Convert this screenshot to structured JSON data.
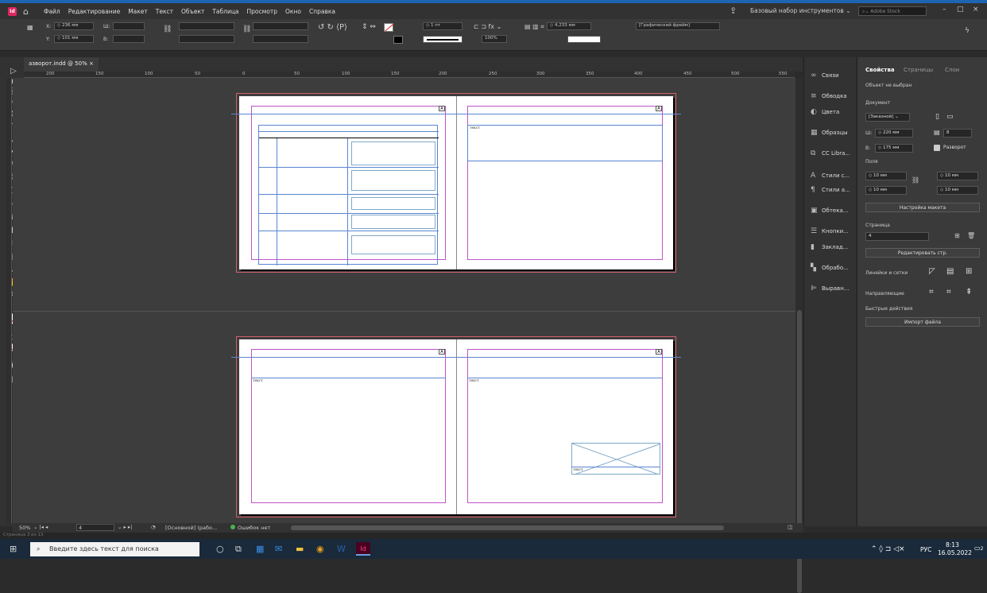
{
  "app": {
    "logo": "Id"
  },
  "menu": [
    "Файл",
    "Редактирование",
    "Макет",
    "Текст",
    "Объект",
    "Таблица",
    "Просмотр",
    "Окно",
    "Справка"
  ],
  "workspace": "Базовый набор инструментов",
  "search_stock": {
    "placeholder": "Adobe Stock"
  },
  "control": {
    "x": "236 мм",
    "y": "101 мм",
    "w_label": "Ш:",
    "h_label": "В:",
    "x_label": "X:",
    "y_label": "Y:",
    "stroke": "1 пт",
    "zoom_pct": "100%",
    "dim": "4,233 мм",
    "frame_type": "[Графический фрейм]"
  },
  "doc_tab": {
    "label": "азворот.indd @ 50%",
    "close": "×"
  },
  "ruler_ticks": [
    "200",
    "150",
    "100",
    "50",
    "0",
    "50",
    "100",
    "150",
    "200",
    "250",
    "300",
    "350",
    "400",
    "450",
    "500",
    "550"
  ],
  "status": {
    "zoom": "50%",
    "page": "4",
    "style": "[Основной] (рабо...",
    "errors": "Ошибок нет",
    "pages_text": "Страница 3 из 13"
  },
  "panel_icons": [
    {
      "icon": "link-icon",
      "label": "Связи"
    },
    {
      "icon": "stroke-icon",
      "label": "Обводка"
    },
    {
      "icon": "color-icon",
      "label": "Цвета"
    },
    {
      "icon": "swatches-icon",
      "label": "Образцы"
    },
    {
      "icon": "cc-libraries-icon",
      "label": "CC Libra..."
    },
    {
      "icon": "char-styles-icon",
      "label": "Стили с..."
    },
    {
      "icon": "para-styles-icon",
      "label": "Стили а..."
    },
    {
      "icon": "text-wrap-icon",
      "label": "Обтека..."
    },
    {
      "icon": "buttons-icon",
      "label": "Кнопки..."
    },
    {
      "icon": "bookmarks-icon",
      "label": "Заклад..."
    },
    {
      "icon": "processing-icon",
      "label": "Обрабо..."
    },
    {
      "icon": "align-icon",
      "label": "Выравн..."
    }
  ],
  "props": {
    "tabs": [
      "Свойства",
      "Страницы",
      "Слои"
    ],
    "no_object": "Объект не выбран",
    "document": "Документ",
    "preset": "[Заказной]",
    "w_label": "Ш:",
    "w": "220 мм",
    "h_label": "В:",
    "h": "175 мм",
    "pages": "8",
    "spread": "Разворот",
    "margins": "Поля",
    "m_top": "10 мм",
    "m_bottom": "10 мм",
    "m_left": "10 мм",
    "m_right": "10 мм",
    "layout_btn": "Настройка макета",
    "page_label": "Страница",
    "page_val": "4",
    "edit_page": "Редактировать стр.",
    "rulers": "Линейки и сетки",
    "guides": "Направляющие",
    "quick": "Быстрые действия",
    "import": "Импорт файла"
  },
  "page_text": "текст",
  "taskbar": {
    "search": "Введите здесь текст для поиска",
    "lang": "РУС",
    "time": "8:13",
    "date": "16.05.2022",
    "notif": "2"
  }
}
